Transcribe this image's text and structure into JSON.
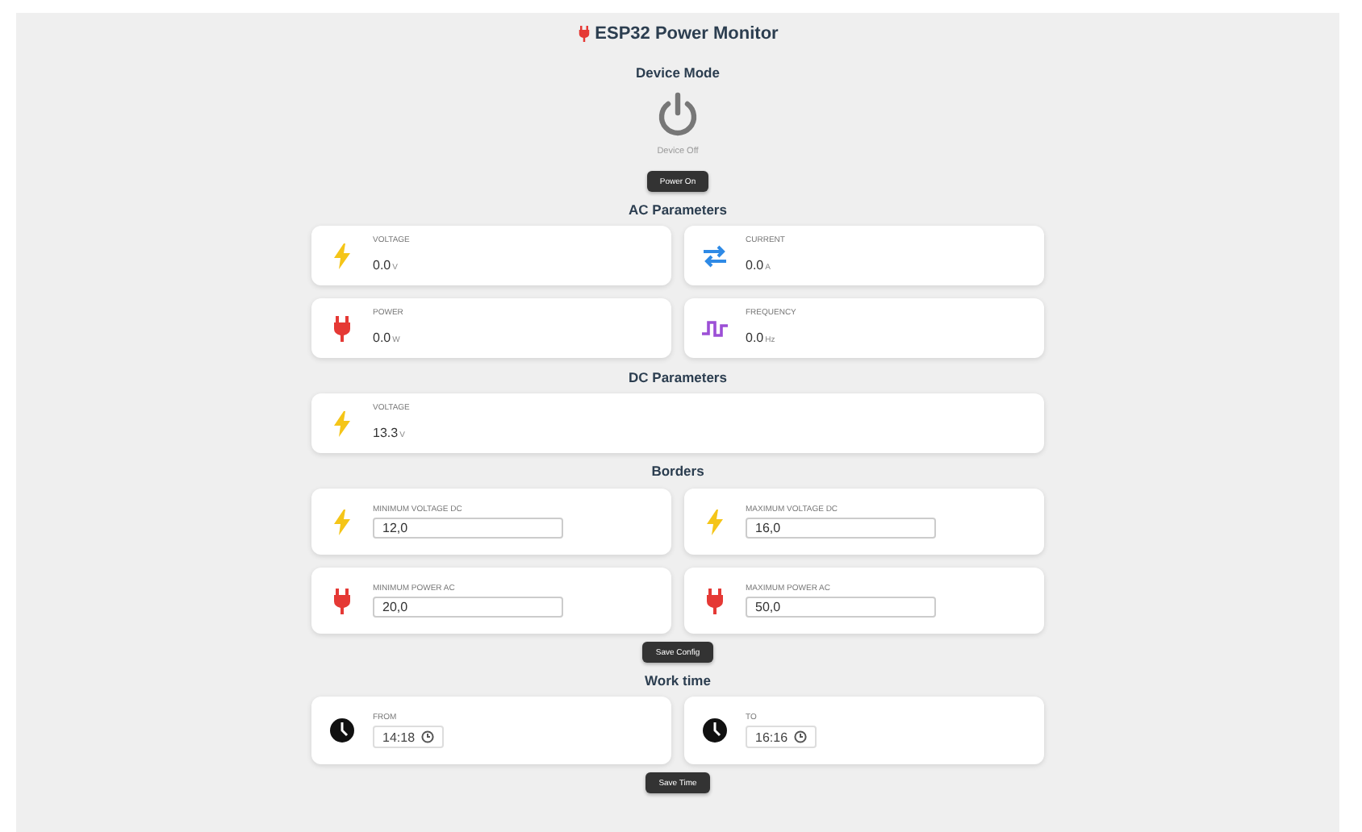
{
  "header": {
    "title": "ESP32 Power Monitor"
  },
  "device": {
    "heading": "Device Mode",
    "on": false,
    "status": "Device Off",
    "button": "Power On"
  },
  "ac": {
    "heading": "AC Parameters",
    "cards": [
      {
        "kind": "bolt",
        "label": "VOLTAGE",
        "value": "0.0",
        "unit": "V"
      },
      {
        "kind": "arrows",
        "label": "CURRENT",
        "value": "0.0",
        "unit": "A"
      },
      {
        "kind": "plug",
        "label": "POWER",
        "value": "0.0",
        "unit": "W"
      },
      {
        "kind": "wave",
        "label": "FREQUENCY",
        "value": "0.0",
        "unit": "Hz"
      }
    ]
  },
  "dc": {
    "heading": "DC Parameters",
    "cards": [
      {
        "kind": "bolt",
        "label": "VOLTAGE",
        "value": "13.3",
        "unit": "V"
      }
    ]
  },
  "borders": {
    "heading": "Borders",
    "cards": [
      {
        "kind": "bolt",
        "label": "MINIMUM VOLTAGE DC",
        "value": "12,0"
      },
      {
        "kind": "bolt",
        "label": "MAXIMUM VOLTAGE DC",
        "value": "16,0"
      },
      {
        "kind": "plug",
        "label": "MINIMUM POWER AC",
        "value": "20,0"
      },
      {
        "kind": "plug",
        "label": "MAXIMUM POWER AC",
        "value": "50,0"
      }
    ],
    "button": "Save Config"
  },
  "work_time": {
    "heading": "Work time",
    "cards": [
      {
        "kind": "clock",
        "label": "FROM",
        "value": "14:18"
      },
      {
        "kind": "clock",
        "label": "TO",
        "value": "16:16"
      }
    ],
    "button": "Save Time"
  }
}
